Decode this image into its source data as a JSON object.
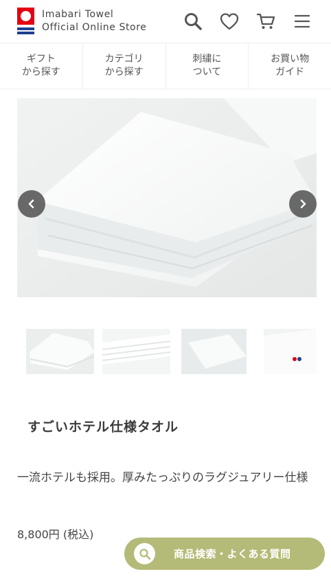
{
  "header": {
    "brand_line1": "Imabari Towel",
    "brand_line2": "Official Online Store",
    "icons": [
      "search-icon",
      "heart-icon",
      "cart-icon",
      "menu-icon"
    ]
  },
  "nav": {
    "items": [
      {
        "label": "ギフト\nから探す"
      },
      {
        "label": "カテゴリ\nから探す"
      },
      {
        "label": "刺繍に\nついて"
      },
      {
        "label": "お買い物\nガイド"
      }
    ]
  },
  "carousel": {
    "prev_icon": "chevron-left-icon",
    "next_icon": "chevron-right-icon"
  },
  "product": {
    "title": "すごいホテル仕様タオル",
    "description": "一流ホテルも採用。厚みたっぷりのラグジュアリー仕様",
    "price": "8,800円 (税込)"
  },
  "floating_search": {
    "label": "商品検索・よくある質問",
    "icon": "search-icon"
  },
  "colors": {
    "logo_red": "#e60012",
    "logo_blue": "#1d3f8f",
    "floating_bg": "#b4ba77"
  }
}
